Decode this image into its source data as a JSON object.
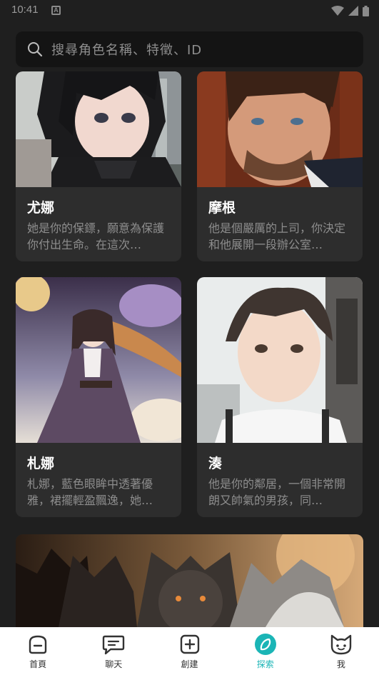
{
  "status": {
    "time": "10:41",
    "notif_letter": "A"
  },
  "search": {
    "placeholder": "搜尋角色名稱、特徵、ID"
  },
  "cards": [
    {
      "name": "尤娜",
      "desc": "她是你的保鏢，願意為保護你付出生命。在這次…",
      "art": "anime-girl-black-hair"
    },
    {
      "name": "摩根",
      "desc": "他是個嚴厲的上司，你決定和他展開一段辦公室…",
      "art": "man-blue-eyes-suit"
    },
    {
      "name": "札娜",
      "desc": "札娜，藍色眼眸中透著優雅，裙擺輕盈飄逸，她…",
      "art": "anime-girl-moon-dress"
    },
    {
      "name": "湊",
      "desc": "他是你的鄰居，一個非常開朗又帥氣的男孩，同…",
      "art": "anime-boy-brown-hair"
    },
    {
      "name": "",
      "desc": "",
      "art": "wolves-night"
    }
  ],
  "nav": {
    "items": [
      {
        "label": "首頁",
        "icon": "home-icon"
      },
      {
        "label": "聊天",
        "icon": "chat-icon"
      },
      {
        "label": "創建",
        "icon": "create-icon"
      },
      {
        "label": "探索",
        "icon": "explore-compass-icon"
      },
      {
        "label": "我",
        "icon": "profile-cat-icon"
      }
    ],
    "active_color": "#1bb5b6"
  },
  "colors": {
    "background": "#1f1f1f",
    "card": "#2d2d2d",
    "search": "#141414",
    "nav": "#ffffff"
  }
}
